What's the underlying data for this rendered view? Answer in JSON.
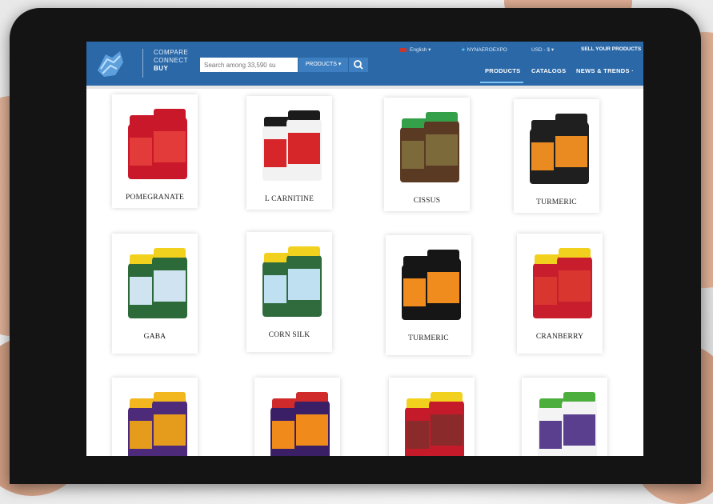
{
  "brand": {
    "line1": "COMPARE",
    "line2": "CONNECT",
    "line3": "BUY"
  },
  "search": {
    "placeholder": "Search among 33,590 su",
    "dropdown_label": "PRODUCTS ▾"
  },
  "utility": {
    "language": "English ▾",
    "expo": "NYNAEROEXPO",
    "currency": "USD - $ ▾",
    "sell": "SELL YOUR PRODUCTS"
  },
  "nav": {
    "products": "PRODUCTS",
    "catalogs": "CATALOGS",
    "news": "NEWS & TRENDS ·"
  },
  "products": [
    {
      "name": "POMEGRANATE",
      "colors": {
        "bottle": "#c9182a",
        "cap": "#c9182a",
        "label": "#e33a3a"
      }
    },
    {
      "name": "L CARNITINE",
      "colors": {
        "bottle": "#f2f2f2",
        "cap": "#1b1b1b",
        "label": "#d6262a"
      }
    },
    {
      "name": "CISSUS",
      "colors": {
        "bottle": "#5b3a24",
        "cap": "#35a04a",
        "label": "#7d6a3a"
      }
    },
    {
      "name": "TURMERIC",
      "colors": {
        "bottle": "#1f1f1f",
        "cap": "#1f1f1f",
        "label": "#e98b20"
      }
    },
    {
      "name": "GABA",
      "colors": {
        "bottle": "#2c6a3a",
        "cap": "#f2d11e",
        "label": "#cfe3f0"
      }
    },
    {
      "name": "CORN SILK",
      "colors": {
        "bottle": "#2f6b3d",
        "cap": "#f2d11e",
        "label": "#bfe0f0"
      }
    },
    {
      "name": "TURMERIC",
      "colors": {
        "bottle": "#161616",
        "cap": "#161616",
        "label": "#f08b1d"
      }
    },
    {
      "name": "CRANBERRY",
      "colors": {
        "bottle": "#c81d2c",
        "cap": "#f2d11e",
        "label": "#d9362f"
      }
    },
    {
      "name": "",
      "colors": {
        "bottle": "#4d2a7a",
        "cap": "#f2b61e",
        "label": "#e59b1c"
      }
    },
    {
      "name": "",
      "colors": {
        "bottle": "#3a1f66",
        "cap": "#d12a2a",
        "label": "#f08a1a"
      }
    },
    {
      "name": "",
      "colors": {
        "bottle": "#c51a2a",
        "cap": "#f2d11e",
        "label": "#8a2a2a"
      }
    },
    {
      "name": "",
      "colors": {
        "bottle": "#f4f4f4",
        "cap": "#4cae3c",
        "label": "#5a3f8f"
      }
    }
  ]
}
